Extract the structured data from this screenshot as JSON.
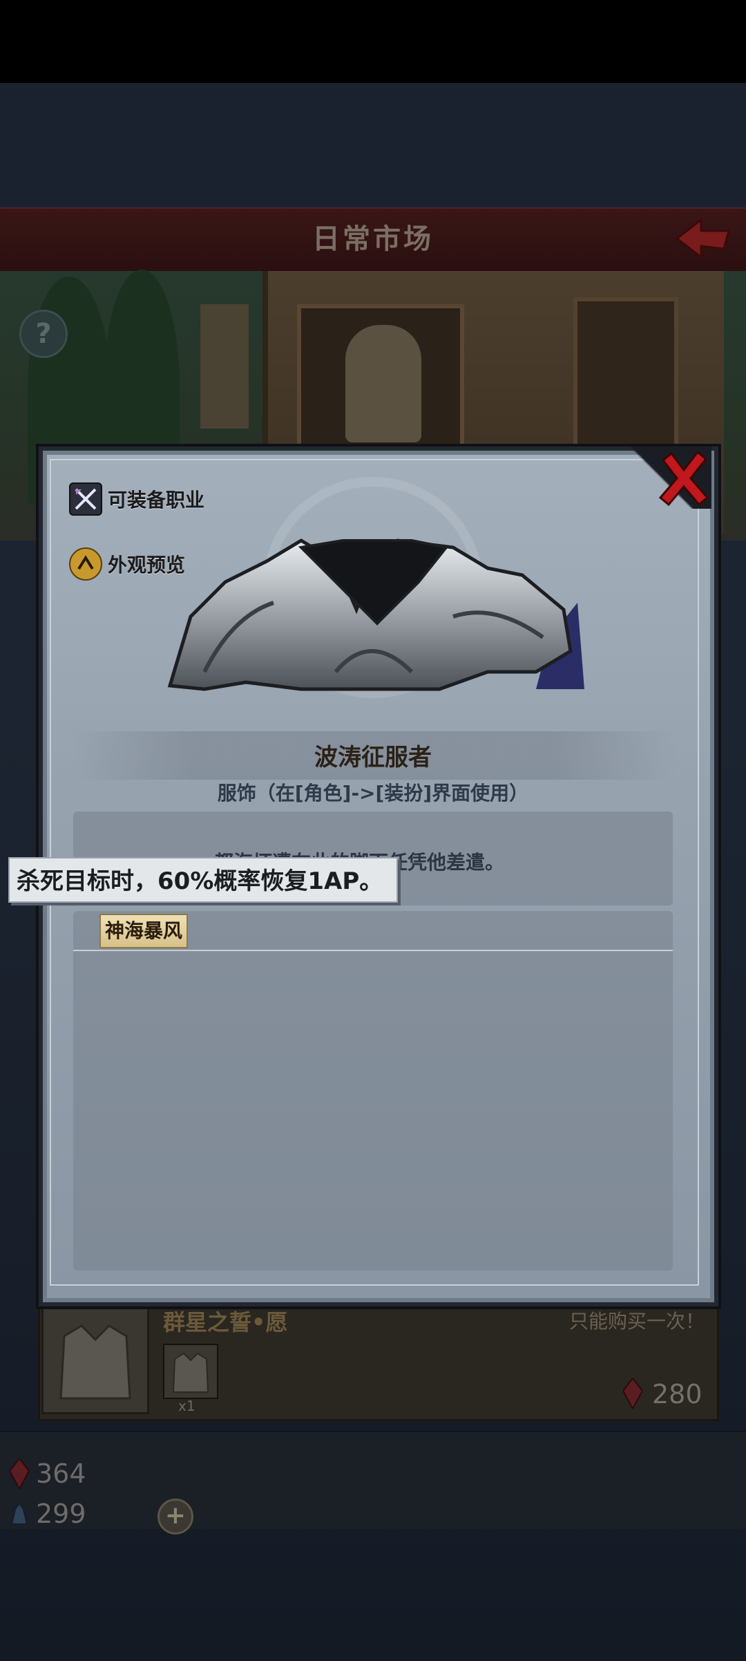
{
  "header": {
    "title": "日常市场"
  },
  "modal": {
    "side_buttons": {
      "equip_class": "可装备职业",
      "appearance_preview": "外观预览"
    },
    "item_name": "波涛征服者",
    "item_type": "服饰（在[角色]->[装扮]界面使用）",
    "description": "都海坏遭在此的脚下任凭他差遣。",
    "set_name": "神海暴风",
    "tooltip": "杀死目标时，60%概率恢复1AP。"
  },
  "shop_item": {
    "title": "群星之誓•愿",
    "limit_note": "只能购买一次！",
    "quantity": "x1",
    "price": "280"
  },
  "currency": {
    "red_gems": "364",
    "blue_gems": "299"
  },
  "colors": {
    "close_red": "#c0181c",
    "gem_red": "#a8222a",
    "gem_blue": "#5d7ea2"
  }
}
